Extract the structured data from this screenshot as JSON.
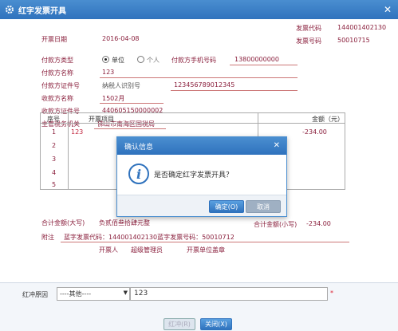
{
  "window": {
    "title": "红字发票开具",
    "close_glyph": "✕"
  },
  "invoice": {
    "code_label": "发票代码",
    "code_value": "144001402130",
    "number_label": "发票号码",
    "number_value": "50010715",
    "date_label": "开票日期",
    "date_value": "2016-04-08",
    "payer_type_label": "付款方类型",
    "payer_type_options": [
      "单位",
      "个人"
    ],
    "payer_type_selected": "单位",
    "payer_phone_label": "付款方手机号码",
    "payer_phone_value": "13800000000",
    "payer_name_label": "付款方名称",
    "payer_name_value": "123",
    "payer_id_label": "付款方证件号",
    "payer_taxid_label": "纳税人识别号",
    "payer_taxid_value": "123456789012345",
    "payee_name_label": "收款方名称",
    "payee_name_value": "1502月",
    "payee_id_label": "收款方证件号",
    "payee_id_value": "440605150000002",
    "authority_label": "主管税务机关",
    "authority_value": "佛山市南海区国税局"
  },
  "table": {
    "col_no": "序号",
    "col_item": "开票项目",
    "col_amount": "金额（元）",
    "rows": [
      {
        "no": "1",
        "item": "123",
        "amount": "-234.00"
      },
      {
        "no": "2",
        "item": "",
        "amount": ""
      },
      {
        "no": "3",
        "item": "",
        "amount": ""
      },
      {
        "no": "4",
        "item": "",
        "amount": ""
      },
      {
        "no": "5",
        "item": "",
        "amount": ""
      }
    ]
  },
  "totals": {
    "upper_label": "合计金额(大写)",
    "upper_value": "负贰佰叁拾肆元整",
    "lower_label": "合计金额(小写)",
    "lower_value": "-234.00",
    "remark_label": "附注",
    "remark_value": "蓝字发票代码：144001402130蓝字发票号码：50010712",
    "issuer_label": "开票人",
    "issuer_value": "超级管理员",
    "seal_label": "开票单位盖章"
  },
  "bottom": {
    "reason_label": "红冲原因",
    "reason_select": "----其他----",
    "reason_input": "123",
    "required_mark": "*",
    "redflush_button": "红冲(R)",
    "close_button": "关闭(X)"
  },
  "dialog": {
    "title": "确认信息",
    "close_glyph": "✕",
    "message": "是否确定红字发票开具？",
    "ok_button": "确定(O)",
    "cancel_button": "取消"
  },
  "colors": {
    "title_bar": "#2f72bd",
    "label": "#8a1f3c",
    "disabled_button": "#dde5ee"
  },
  "icons": {
    "window_icon": "gear-icon",
    "dialog_icon": "info-icon"
  }
}
